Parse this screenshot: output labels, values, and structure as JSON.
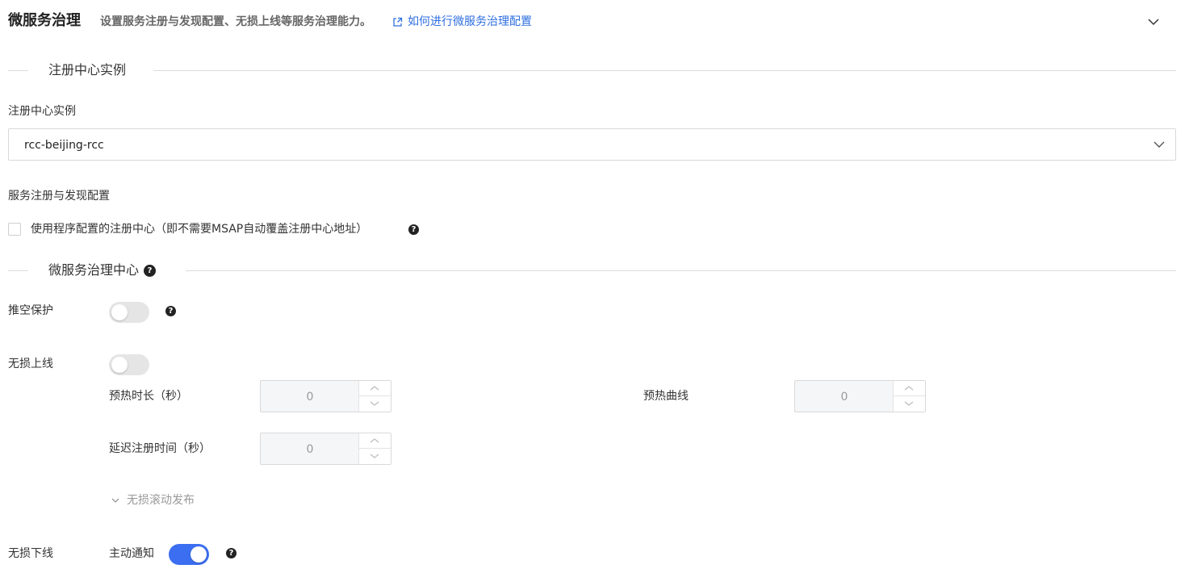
{
  "header": {
    "title": "微服务治理",
    "description": "设置服务注册与发现配置、无损上线等服务治理能力。",
    "doc_link": "如何进行微服务治理配置"
  },
  "registry_section": {
    "title": "注册中心实例",
    "instance_label": "注册中心实例",
    "instance_value": "rcc-beijing-rcc"
  },
  "discovery": {
    "label": "服务注册与发现配置",
    "checkbox_label": "使用程序配置的注册中心（即不需要MSAP自动覆盖注册中心地址）",
    "checked": false
  },
  "governance_section": {
    "title": "微服务治理中心"
  },
  "push_protect": {
    "label": "推空保护",
    "enabled": false
  },
  "lossless_online": {
    "label": "无损上线",
    "enabled": false,
    "warmup_duration_label": "预热时长（秒）",
    "warmup_duration_value": "0",
    "warmup_curve_label": "预热曲线",
    "warmup_curve_value": "0",
    "delay_register_label": "延迟注册时间（秒）",
    "delay_register_value": "0",
    "rolling_release_label": "无损滚动发布"
  },
  "lossless_offline": {
    "label": "无损下线",
    "active_notify_label": "主动通知",
    "active_notify_enabled": true
  },
  "colors": {
    "accent": "#3b6ef0",
    "link": "#2f6fe0",
    "switch_off": "#e5e5e5"
  },
  "icons": {
    "external_link": "external-link-icon",
    "chevron_down": "chevron-down-icon",
    "help": "help-icon"
  }
}
